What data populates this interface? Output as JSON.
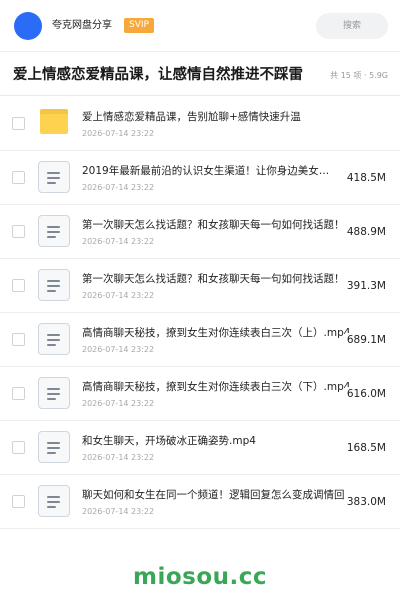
{
  "header": {
    "username": "夸克网盘分享",
    "vip_badge": "SVIP",
    "search_placeholder": "搜索",
    "avatar_color": "#2a6cf6"
  },
  "share": {
    "title": "爱上情感恋爱精品课，让感情自然推进不踩雷",
    "meta": "共 15 项 · 5.9G"
  },
  "files": [
    {
      "icon": "folder-icon",
      "name": "爱上情感恋爱精品课，告别尬聊+感情快速升温",
      "date": "2026-07-14 23:22",
      "size": ""
    },
    {
      "icon": "doc-icon",
      "name": "2019年最新最前沿的认识女生渠道！让你身边美女…",
      "date": "2026-07-14 23:22",
      "size": "418.5M"
    },
    {
      "icon": "doc-icon",
      "name": "第一次聊天怎么找话题？和女孩聊天每一句如何找话题！",
      "date": "2026-07-14 23:22",
      "size": "488.9M"
    },
    {
      "icon": "doc-icon",
      "name": "第一次聊天怎么找话题？和女孩聊天每一句如何找话题！",
      "date": "2026-07-14 23:22",
      "size": "391.3M"
    },
    {
      "icon": "doc-icon",
      "name": "高情商聊天秘技，撩到女生对你连续表白三次（上）.mp4",
      "date": "2026-07-14 23:22",
      "size": "689.1M"
    },
    {
      "icon": "doc-icon",
      "name": "高情商聊天秘技，撩到女生对你连续表白三次（下）.mp4",
      "date": "2026-07-14 23:22",
      "size": "616.0M"
    },
    {
      "icon": "doc-icon",
      "name": "和女生聊天，开场破冰正确姿势.mp4",
      "date": "2026-07-14 23:22",
      "size": "168.5M"
    },
    {
      "icon": "doc-icon",
      "name": "聊天如何和女生在同一个频道！逻辑回复怎么变成调情回…",
      "date": "2026-07-14 23:22",
      "size": "383.0M"
    }
  ],
  "watermark": "miosou.cc"
}
